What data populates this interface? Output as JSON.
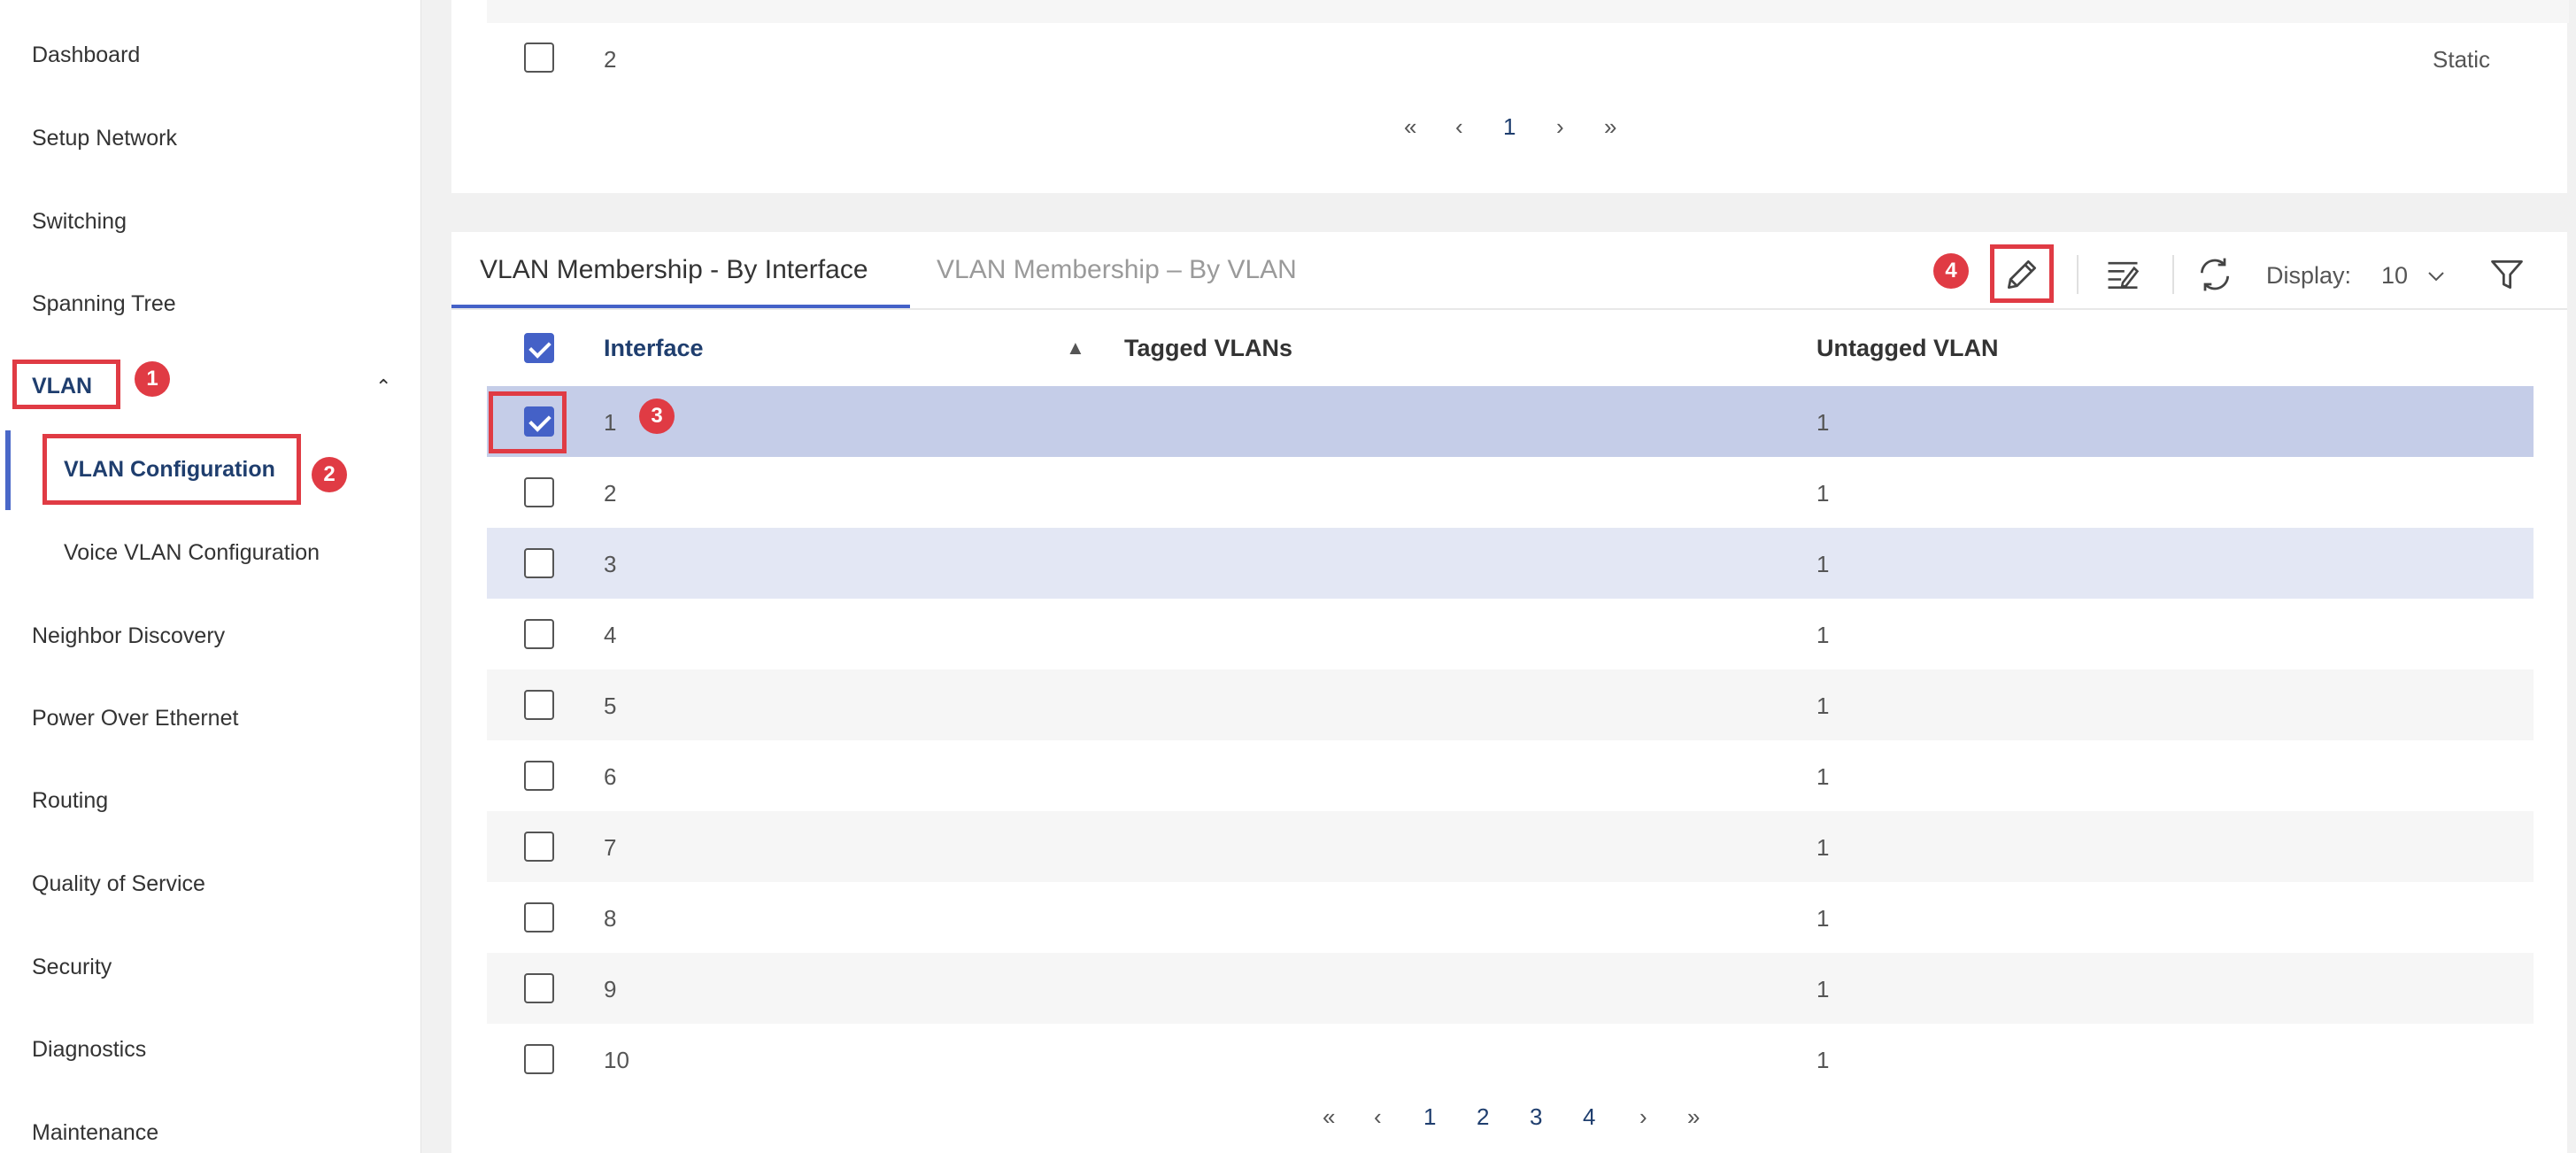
{
  "sidebar": {
    "items": [
      {
        "label": "Dashboard"
      },
      {
        "label": "Setup Network"
      },
      {
        "label": "Switching"
      },
      {
        "label": "Spanning Tree"
      },
      {
        "label": "VLAN"
      },
      {
        "label": "VLAN Configuration"
      },
      {
        "label": "Voice VLAN Configuration"
      },
      {
        "label": "Neighbor Discovery"
      },
      {
        "label": "Power Over Ethernet"
      },
      {
        "label": "Routing"
      },
      {
        "label": "Quality of Service"
      },
      {
        "label": "Security"
      },
      {
        "label": "Diagnostics"
      },
      {
        "label": "Maintenance"
      }
    ]
  },
  "annotations": [
    "1",
    "2",
    "3",
    "4"
  ],
  "top_table": {
    "row": {
      "id": "2",
      "type": "Static"
    },
    "pager": {
      "first": "«",
      "prev": "‹",
      "current": "1",
      "next": "›",
      "last": "»"
    }
  },
  "main": {
    "tabs": [
      {
        "label": "VLAN Membership - By Interface"
      },
      {
        "label": "VLAN Membership – By VLAN"
      }
    ],
    "toolbar": {
      "display_label": "Display:",
      "display_value": "10"
    },
    "columns": [
      "Interface",
      "Tagged VLANs",
      "Untagged VLAN"
    ],
    "sort_indicator": "▲",
    "rows": [
      {
        "interface": "1",
        "tagged": "",
        "untagged": "1"
      },
      {
        "interface": "2",
        "tagged": "",
        "untagged": "1"
      },
      {
        "interface": "3",
        "tagged": "",
        "untagged": "1"
      },
      {
        "interface": "4",
        "tagged": "",
        "untagged": "1"
      },
      {
        "interface": "5",
        "tagged": "",
        "untagged": "1"
      },
      {
        "interface": "6",
        "tagged": "",
        "untagged": "1"
      },
      {
        "interface": "7",
        "tagged": "",
        "untagged": "1"
      },
      {
        "interface": "8",
        "tagged": "",
        "untagged": "1"
      },
      {
        "interface": "9",
        "tagged": "",
        "untagged": "1"
      },
      {
        "interface": "10",
        "tagged": "",
        "untagged": "1"
      }
    ],
    "pager": {
      "first": "«",
      "prev": "‹",
      "pages": [
        "1",
        "2",
        "3",
        "4"
      ],
      "next": "›",
      "last": "»"
    }
  },
  "colors": {
    "accent": "#4461c7",
    "highlight": "#e03b44",
    "selected_row": "#c5cde8"
  }
}
